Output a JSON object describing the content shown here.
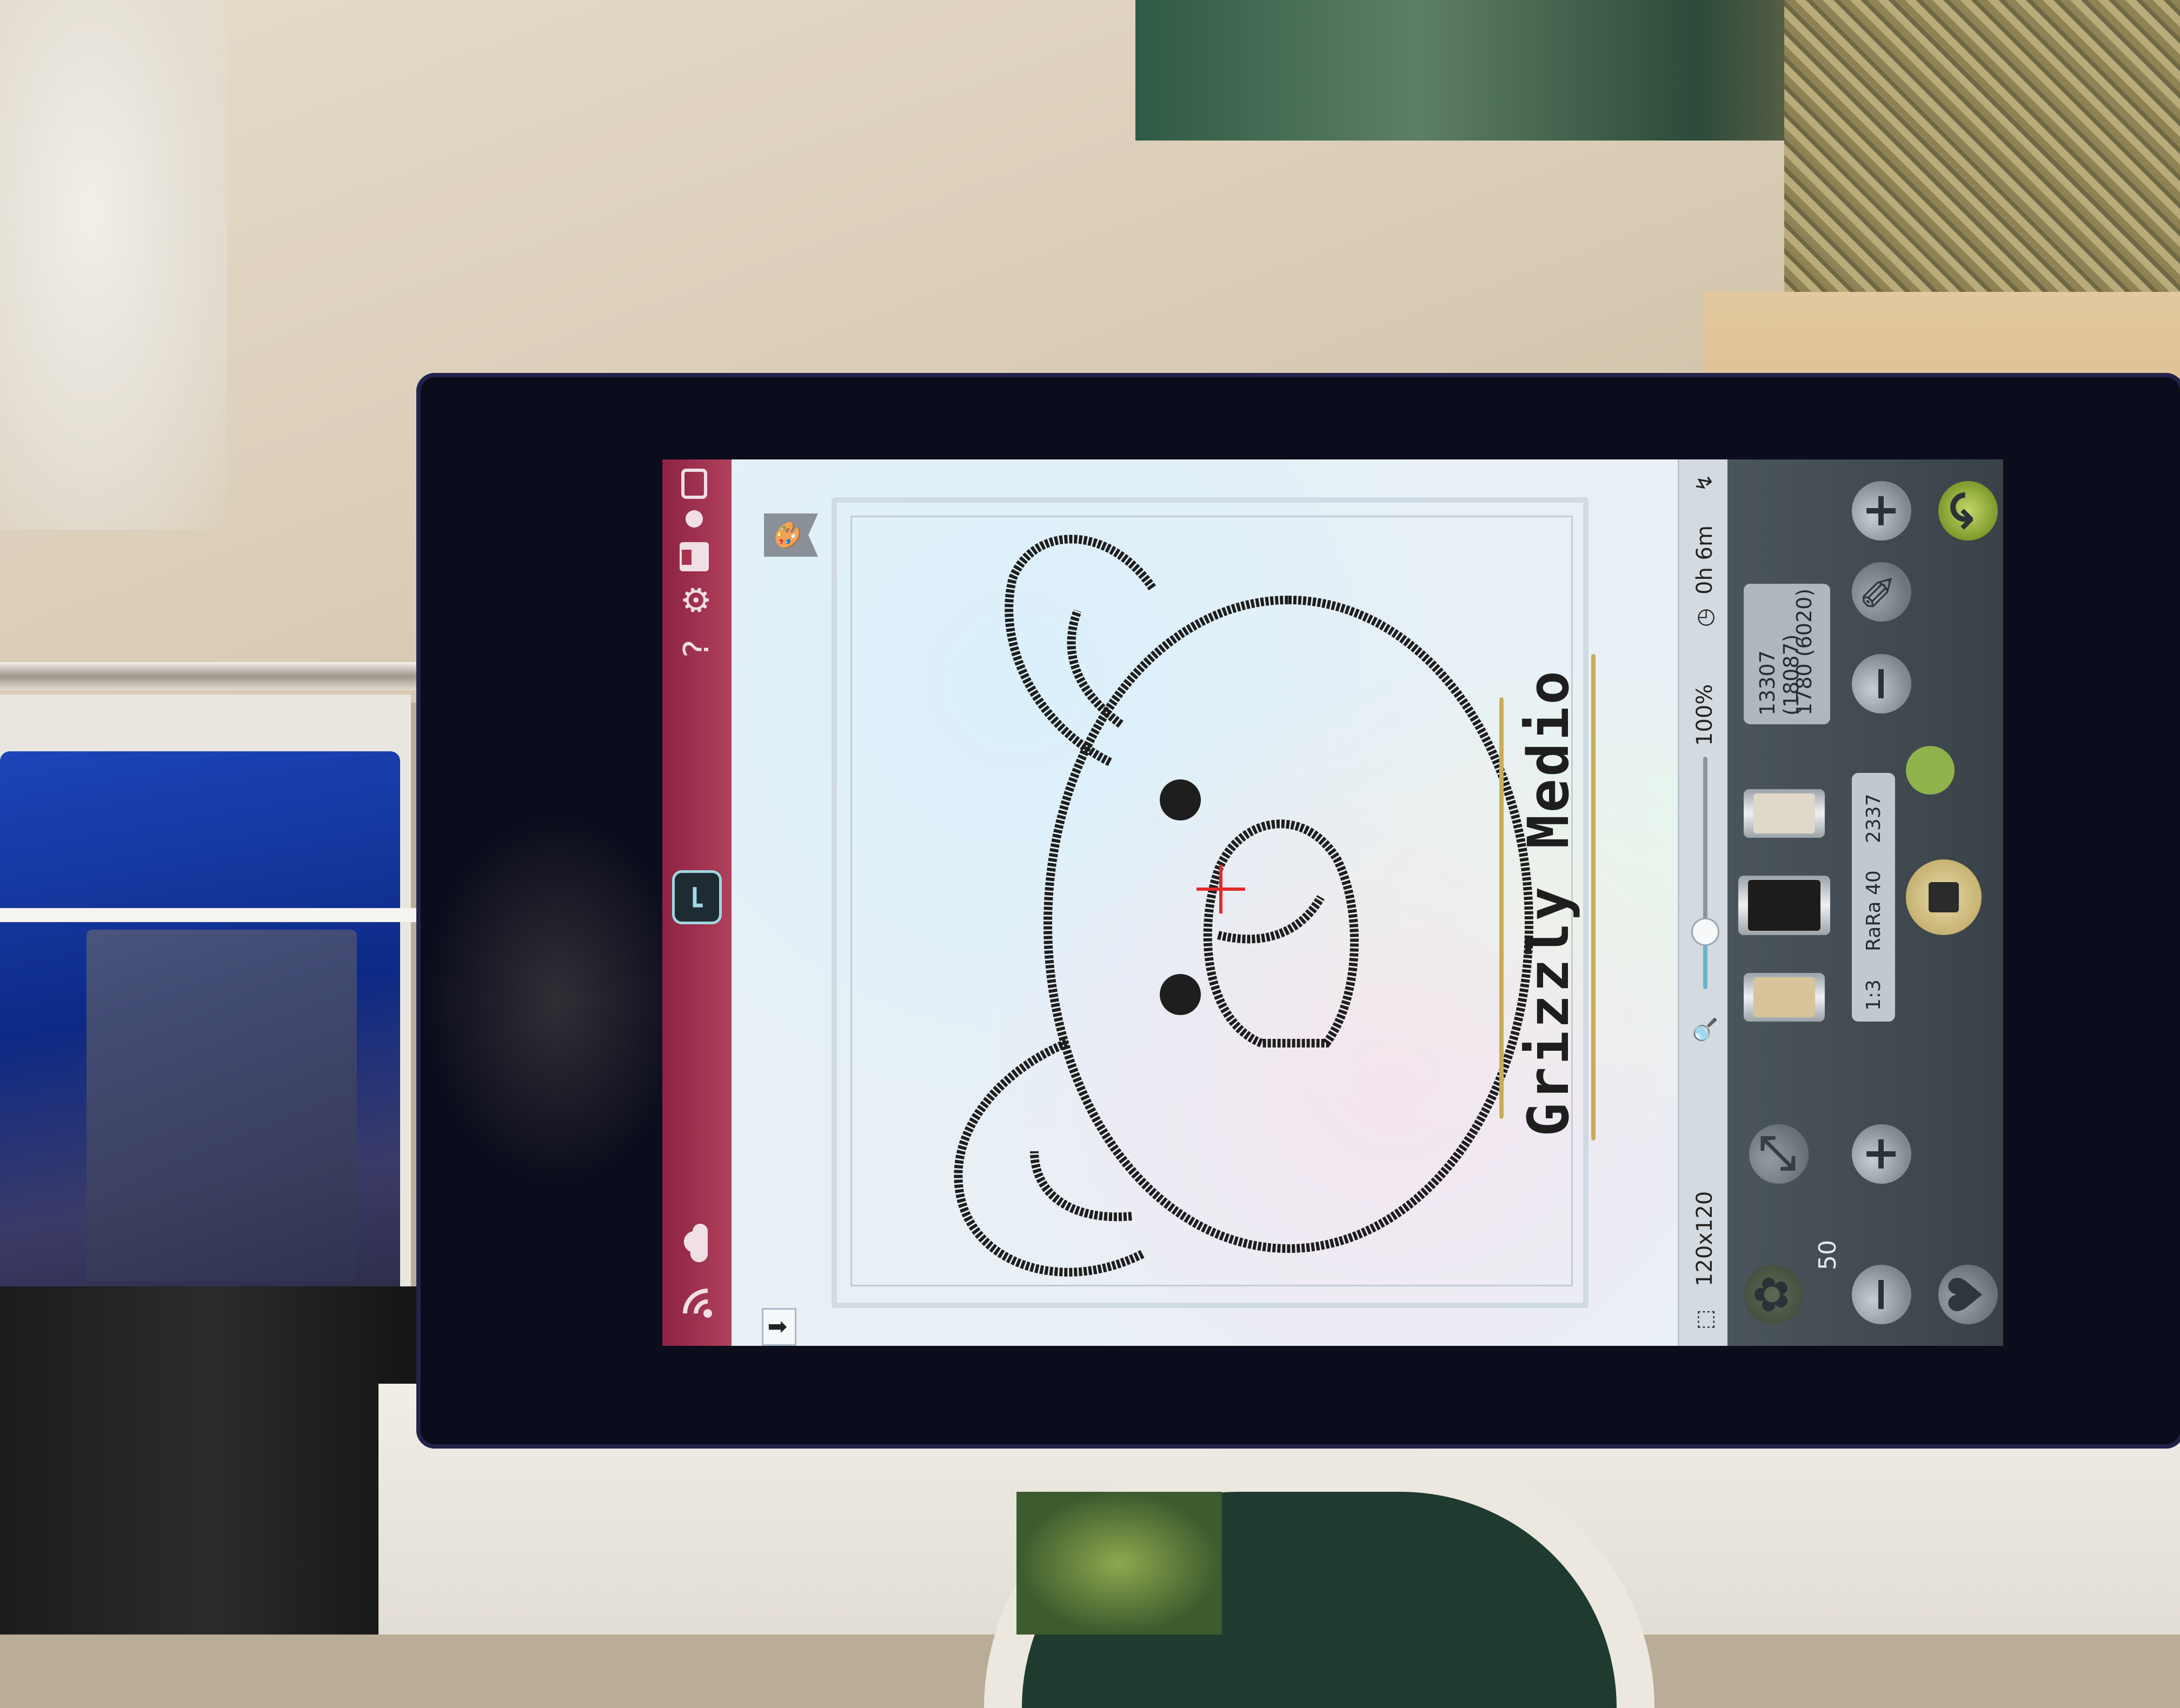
{
  "colors": {
    "status_bar": "#a0304f",
    "canvas": "#e8f0f6",
    "control_panel": "#434c52",
    "stitch": "#1e1e1e",
    "gold_thread": "#c9ad55",
    "crosshair": "#e42a2a"
  },
  "status_bar": {
    "icons": [
      "wifi-icon",
      "cloud-icon",
      "home-icon",
      "help-icon",
      "settings-icon",
      "save-icon",
      "record-icon",
      "window-icon"
    ],
    "help_glyph": "?"
  },
  "design": {
    "text": "Grizzly Medio",
    "shape": "bear-head"
  },
  "info_bar": {
    "hoop_size": "120x120",
    "zoom_percent": "100%",
    "zoom_level": 0.25,
    "time": "0h 6m"
  },
  "control_panel": {
    "stitch_count": "13307 (18087)",
    "stitch_count_secondary": "1780 (6020)",
    "thread_info": "RaRa 40",
    "thread_number": "2337",
    "color_position": "1:3",
    "speed_value": "50",
    "plus_label": "+",
    "minus_label": "−",
    "thread_colors": [
      "#d8c39a",
      "#1c1c1c",
      "#e0d8c8"
    ]
  }
}
